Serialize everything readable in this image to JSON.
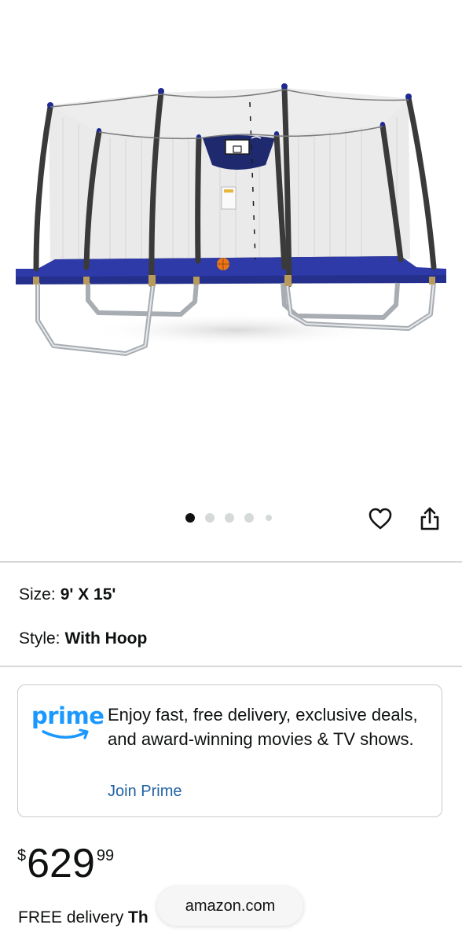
{
  "carousel": {
    "total_dots": 5,
    "active_index": 0
  },
  "icons": {
    "wishlist": "heart-icon",
    "share": "share-icon"
  },
  "variations": {
    "size_label": "Size:",
    "size_value": "9' X 15'",
    "style_label": "Style:",
    "style_value": "With Hoop"
  },
  "prime": {
    "logo_text": "prime",
    "description": "Enjoy fast, free delivery, exclusive deals, and award-winning movies & TV shows.",
    "join_link": "Join Prime",
    "brand_color": "#1a98ff",
    "link_color": "#2162a1"
  },
  "price": {
    "currency_symbol": "$",
    "whole": "629",
    "fraction": "99"
  },
  "delivery": {
    "prefix": "FREE delivery",
    "date_visible": "Th"
  },
  "browser": {
    "url": "amazon.com"
  }
}
